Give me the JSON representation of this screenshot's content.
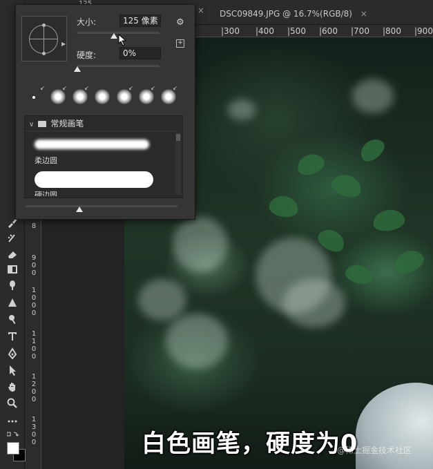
{
  "options_bar": {
    "size_value": "125"
  },
  "tabs": [
    {
      "label": "*",
      "close": "×"
    },
    {
      "label": "DSC09849.JPG @ 16.7%(RGB/8)",
      "close": "×"
    }
  ],
  "ruler_top": [
    "|300",
    "|400",
    "|500",
    "|600",
    "|700",
    "|800",
    "|900"
  ],
  "ruler_left": [
    [
      "8"
    ],
    [
      "9",
      "0",
      "0"
    ],
    [
      "1",
      "0",
      "0",
      "0"
    ],
    [
      "1",
      "1",
      "0",
      "0"
    ],
    [
      "1",
      "2",
      "0",
      "0"
    ],
    [
      "1",
      "3",
      "0",
      "0"
    ]
  ],
  "brush_panel": {
    "size_label": "大小:",
    "size_value": "125 像素",
    "hardness_label": "硬度:",
    "hardness_value": "0%",
    "size_slider_fraction": 0.45,
    "hardness_slider_fraction": 0.0,
    "group_name": "常规画笔",
    "presets": [
      {
        "name": "柔边圆"
      },
      {
        "name": "硬边圆"
      }
    ]
  },
  "subtitle": "白色画笔，硬度为0",
  "watermark": "@稀土掘金技术社区",
  "colors": {
    "foreground": "#ffffff",
    "background": "#000000"
  },
  "icons": [
    "gear-icon",
    "new-preset-icon",
    "folder-icon",
    "chevron-down-icon"
  ]
}
